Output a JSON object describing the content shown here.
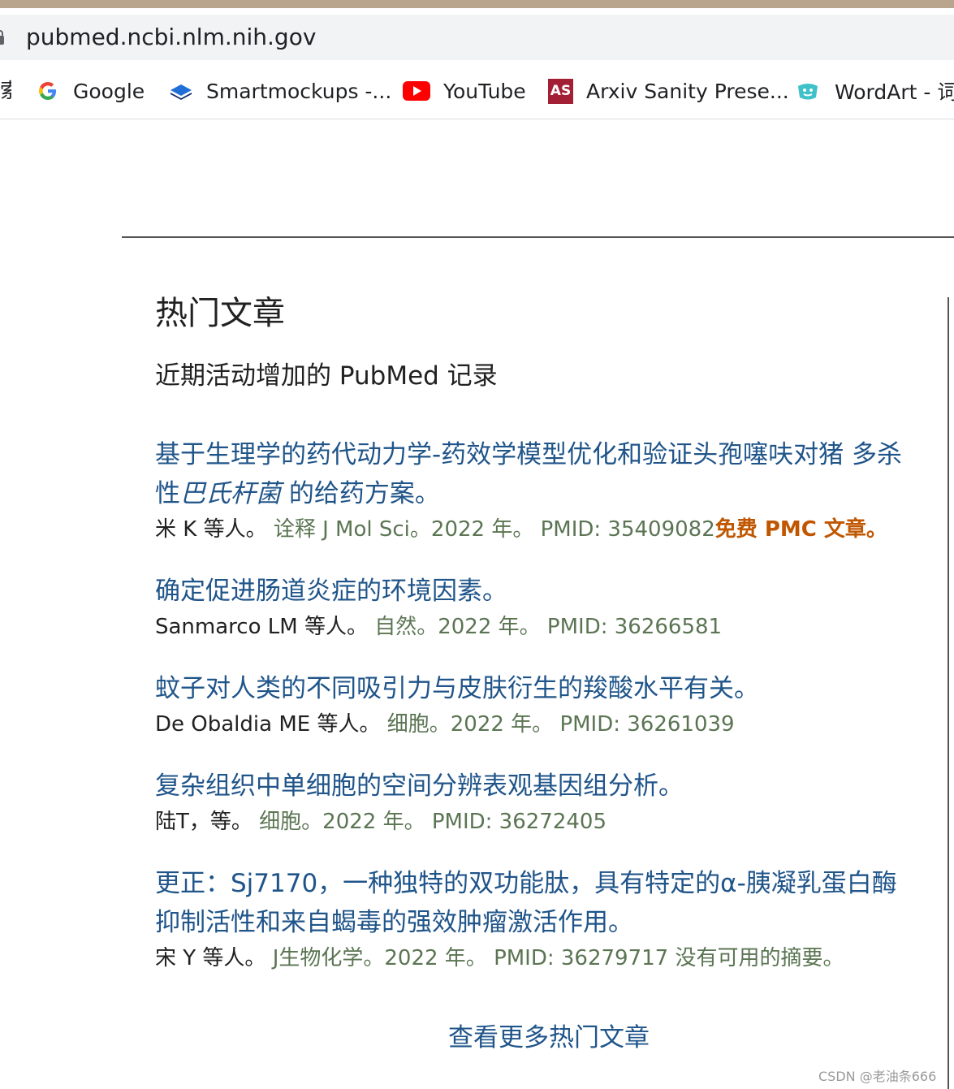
{
  "browser": {
    "url": "pubmed.ncbi.nlm.nih.gov",
    "bookmarks": [
      {
        "label": "索",
        "icon": "cut-off-bookmark"
      },
      {
        "label": "Google",
        "icon": "google-icon"
      },
      {
        "label": "Smartmockups -...",
        "icon": "smartmockups-icon"
      },
      {
        "label": "YouTube",
        "icon": "youtube-icon"
      },
      {
        "label": "Arxiv Sanity Prese...",
        "icon": "arxiv-sanity-icon"
      },
      {
        "label": "WordArt - 词",
        "icon": "wordart-icon"
      }
    ],
    "arxiv_badge": "AS"
  },
  "section": {
    "title": "热门文章",
    "subtitle": "近期活动增加的 PubMed 记录"
  },
  "articles": [
    {
      "title_before": "基于生理学的药代动力学-药效学模型优化和验证头孢噻呋对猪 多杀性",
      "title_italic": "巴氏杆菌",
      "title_after": " 的给药方案。",
      "authors": "米 K 等人。",
      "source": "诠释 J Mol Sci。2022 年。",
      "pmid": "PMID: 35409082",
      "note": "免费 PMC 文章。"
    },
    {
      "title": "确定促进肠道炎症的环境因素。",
      "authors": "Sanmarco LM 等人。",
      "source": "自然。2022 年。",
      "pmid": "PMID: 36266581"
    },
    {
      "title": "蚊子对人类的不同吸引力与皮肤衍生的羧酸水平有关。",
      "authors": "De Obaldia ME 等人。",
      "source": "细胞。2022 年。",
      "pmid": "PMID: 36261039"
    },
    {
      "title": "复杂组织中单细胞的空间分辨表观基因组分析。",
      "authors": "陆T，等。",
      "source": "细胞。2022 年。",
      "pmid": "PMID: 36272405"
    },
    {
      "title": "更正：Sj7170，一种独特的双功能肽，具有特定的α-胰凝乳蛋白酶抑制活性和来自蝎毒的强效肿瘤激活作用。",
      "authors": "宋 Y 等人。",
      "source": "J生物化学。2022 年。",
      "pmid": "PMID: 36279717 没有可用的摘要。"
    }
  ],
  "more_link": "查看更多热门文章",
  "watermark": "CSDN @老油条666",
  "colors": {
    "link": "#20558a",
    "source": "#5b7553",
    "free_pmc": "#c05600"
  }
}
